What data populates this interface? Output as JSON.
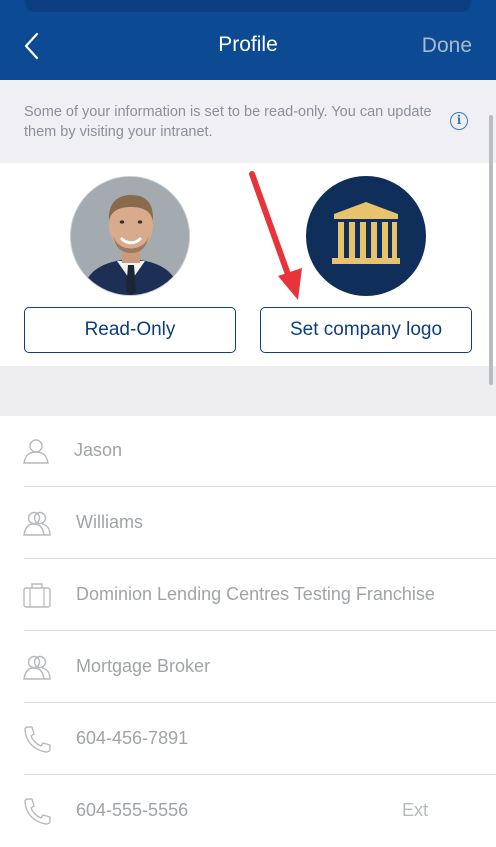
{
  "nav": {
    "title": "Profile",
    "done_label": "Done",
    "back_icon": "chevron-left-icon",
    "background": "#0d4a94"
  },
  "notice": {
    "text": "Some of your information is set to be read-only. You can update them by visiting your intranet.",
    "icon": "info-icon"
  },
  "profile": {
    "read_only_label": "Read-Only",
    "set_logo_label": "Set company logo"
  },
  "fields": [
    {
      "icon": "person-icon",
      "value": "Jason"
    },
    {
      "icon": "people-icon",
      "value": "Williams"
    },
    {
      "icon": "briefcase-icon",
      "value": "Dominion Lending Centres Testing Franchise"
    },
    {
      "icon": "people-icon",
      "value": "Mortgage Broker"
    },
    {
      "icon": "phone-icon",
      "value": "604-456-7891"
    },
    {
      "icon": "phone-icon",
      "value": "604-555-5556",
      "ext_label": "Ext"
    }
  ],
  "colors": {
    "accent": "#0d3f7c",
    "annotation_arrow": "#e8333b",
    "logo_gold": "#e9c36b"
  }
}
